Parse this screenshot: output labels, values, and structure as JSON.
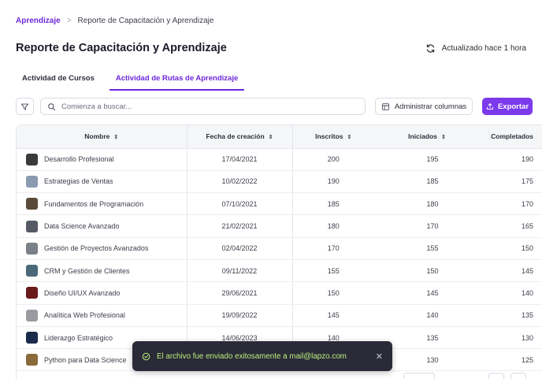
{
  "breadcrumb": {
    "root": "Aprendizaje",
    "separator": ">",
    "current": "Reporte de Capacitación y Aprendizaje"
  },
  "page": {
    "title": "Reporte de Capacitación y Aprendizaje",
    "updated": "Actualizado hace 1 hora"
  },
  "tabs": [
    {
      "label": "Actividad de Cursos",
      "active": false
    },
    {
      "label": "Actividad de Rutas de Aprendizaje",
      "active": true
    }
  ],
  "toolbar": {
    "search_placeholder": "Comienza a buscar...",
    "manage_columns": "Administrar columnas",
    "export": "Exportar"
  },
  "table": {
    "headers": [
      "Nombre",
      "Fecha de creación",
      "Inscritos",
      "Iniciados",
      "Completados"
    ],
    "rows": [
      {
        "name": "Desarrollo Profesional",
        "date": "17/04/2021",
        "enrolled": "200",
        "started": "195",
        "completed": "190",
        "thumb": "#3a3a3a"
      },
      {
        "name": "Estrategias de Ventas",
        "date": "10/02/2022",
        "enrolled": "190",
        "started": "185",
        "completed": "175",
        "thumb": "#8a9bb0"
      },
      {
        "name": "Fundamentos de Programación",
        "date": "07/10/2021",
        "enrolled": "185",
        "started": "180",
        "completed": "170",
        "thumb": "#5a4a3a"
      },
      {
        "name": "Data Science Avanzado",
        "date": "21/02/2021",
        "enrolled": "180",
        "started": "170",
        "completed": "165",
        "thumb": "#555a66"
      },
      {
        "name": "Gestión de Proyectos Avanzados",
        "date": "02/04/2022",
        "enrolled": "170",
        "started": "155",
        "completed": "150",
        "thumb": "#7a8088"
      },
      {
        "name": "CRM y Gestión de Clientes",
        "date": "09/11/2022",
        "enrolled": "155",
        "started": "150",
        "completed": "145",
        "thumb": "#4a6a7a"
      },
      {
        "name": "Diseño UI/UX Avanzado",
        "date": "29/06/2021",
        "enrolled": "150",
        "started": "145",
        "completed": "140",
        "thumb": "#6a1a1a"
      },
      {
        "name": "Analítica Web Profesional",
        "date": "19/09/2022",
        "enrolled": "145",
        "started": "140",
        "completed": "135",
        "thumb": "#9a9aa0"
      },
      {
        "name": "Liderazgo Estratégico",
        "date": "14/06/2023",
        "enrolled": "140",
        "started": "135",
        "completed": "130",
        "thumb": "#1a2a4a"
      },
      {
        "name": "Python para Data Science",
        "date": "",
        "enrolled": "",
        "started": "130",
        "completed": "125",
        "thumb": "#8a6a3a"
      }
    ]
  },
  "toast": {
    "message": "El archivo fue enviado exitosamente a mail@lapzo.com",
    "close": "✕"
  },
  "colors": {
    "accent": "#7c3aed",
    "toast_bg": "#2b2a38",
    "toast_text": "#b8f07c"
  }
}
